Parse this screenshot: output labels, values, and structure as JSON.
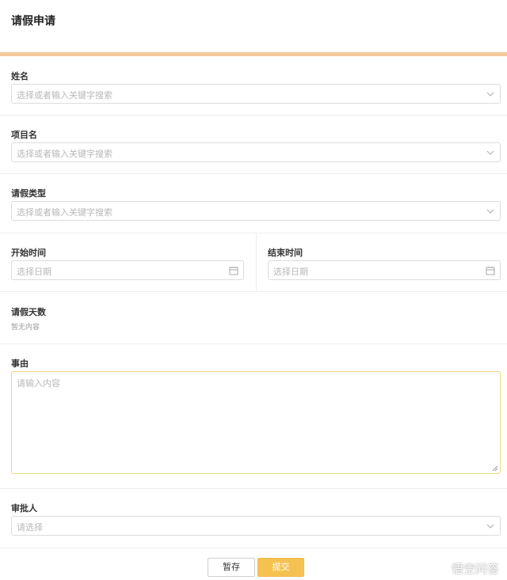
{
  "header": {
    "title": "请假申请"
  },
  "form": {
    "name": {
      "label": "姓名",
      "placeholder": "选择或者输入关键字搜索"
    },
    "project": {
      "label": "项目名",
      "placeholder": "选择或者输入关键字搜索"
    },
    "leave_type": {
      "label": "请假类型",
      "placeholder": "选择或者输入关键字搜索"
    },
    "start_time": {
      "label": "开始时间",
      "placeholder": "选择日期"
    },
    "end_time": {
      "label": "结束时间",
      "placeholder": "选择日期"
    },
    "days": {
      "label": "请假天数",
      "value": "暂无内容"
    },
    "reason": {
      "label": "事由",
      "placeholder": "请输入内容"
    },
    "approver": {
      "label": "审批人",
      "placeholder": "请选择"
    }
  },
  "footer": {
    "save_label": "暂存",
    "submit_label": "提交"
  },
  "watermark": {
    "text": "悟空问答"
  },
  "colors": {
    "accent_bar": "#f3c89a",
    "submit_button": "#f5c252",
    "focus_border": "#f0d77c"
  },
  "icons": [
    "chevron-down-icon",
    "calendar-icon",
    "resize-handle-icon",
    "wukong-logo-icon"
  ]
}
